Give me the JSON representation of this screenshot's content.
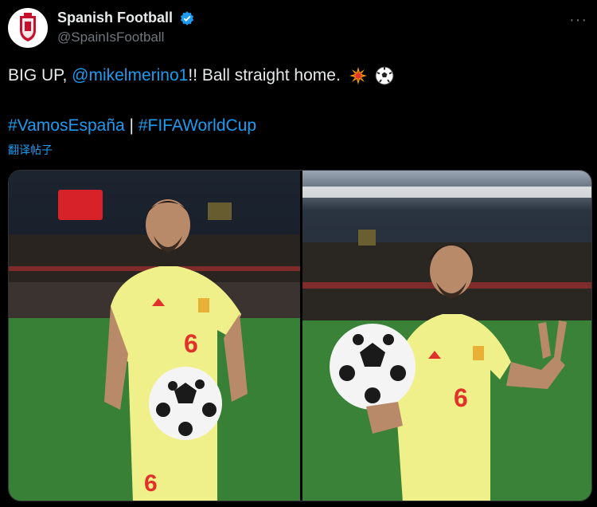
{
  "author": {
    "display_name": "Spanish Football",
    "handle": "@SpainIsFootball",
    "avatar_icon": "spain-crest-icon",
    "verified_icon": "verified-badge-icon"
  },
  "menu": {
    "more_label": "···"
  },
  "tweet": {
    "text_prefix": "BIG UP, ",
    "mention": "@mikelmerino1",
    "text_suffix": "!! Ball straight home.",
    "emojis": [
      "collision-icon",
      "soccer-ball-icon"
    ],
    "hashtag_1": "#VamosEspaña",
    "separator": " | ",
    "hashtag_2": "#FIFAWorldCup",
    "translate_label": "翻译帖子"
  },
  "media": {
    "jersey_number": "6",
    "colors": {
      "jersey": "#f0f08a",
      "number": "#e0322a",
      "pitch": "#3c8a3a",
      "accent": "#1d9bf0"
    }
  }
}
